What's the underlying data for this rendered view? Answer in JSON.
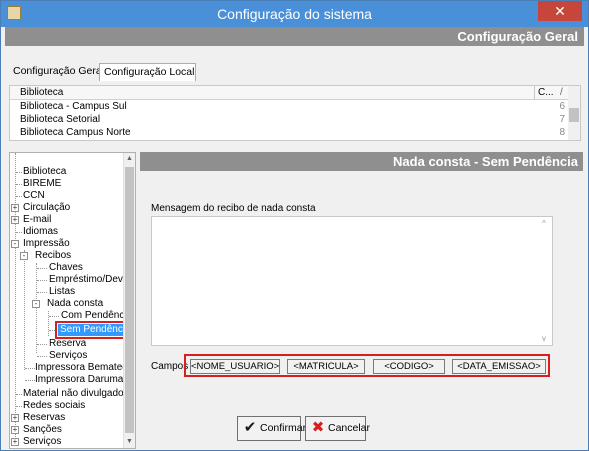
{
  "window": {
    "title": "Configuração do sistema",
    "close_glyph": "✕"
  },
  "header": {
    "title": "Configuração Geral"
  },
  "tabs": [
    {
      "label": "Configuração Geral",
      "active": false
    },
    {
      "label": "Configuração Local",
      "active": true
    }
  ],
  "libraries": {
    "columns": [
      "Biblioteca",
      "C..."
    ],
    "sort_glyph": "/",
    "rows": [
      {
        "name": "Biblioteca - Campus Sul",
        "code": "6"
      },
      {
        "name": "Biblioteca Setorial",
        "code": "7"
      },
      {
        "name": "Biblioteca Campus Norte",
        "code": "8"
      }
    ]
  },
  "tree": {
    "items": [
      {
        "label": "Biblioteca"
      },
      {
        "label": "BIREME"
      },
      {
        "label": "CCN"
      },
      {
        "label": "Circulação",
        "expander": "+"
      },
      {
        "label": "E-mail",
        "expander": "+"
      },
      {
        "label": "Idiomas"
      },
      {
        "label": "Impressão",
        "expander": "-"
      },
      {
        "label": "Recibos",
        "expander": "-"
      },
      {
        "label": "Chaves"
      },
      {
        "label": "Empréstimo/Devolu"
      },
      {
        "label": "Listas"
      },
      {
        "label": "Nada consta",
        "expander": "-"
      },
      {
        "label": "Com Pendência"
      },
      {
        "label": "Sem Pendência",
        "selected": true
      },
      {
        "label": "Reserva"
      },
      {
        "label": "Serviços"
      },
      {
        "label": "Impressora Bematech"
      },
      {
        "label": "Impressora Daruma"
      },
      {
        "label": "Material não divulgado"
      },
      {
        "label": "Redes sociais"
      },
      {
        "label": "Reservas",
        "expander": "+"
      },
      {
        "label": "Sanções",
        "expander": "+"
      },
      {
        "label": "Serviços",
        "expander": "+"
      }
    ]
  },
  "panel": {
    "title": "Nada consta - Sem Pendência",
    "message_label": "Mensagem do recibo de nada consta",
    "message_value": "",
    "fields_label": "Campos",
    "fields": [
      "<NOME_USUARIO>",
      "<MATRICULA>",
      "<CODIGO>",
      "<DATA_EMISSAO>"
    ]
  },
  "actions": {
    "confirm_label": "Confirmar",
    "cancel_label": "Cancelar",
    "confirm_color": "#1a1a1a",
    "cancel_color": "#d91e1e"
  }
}
